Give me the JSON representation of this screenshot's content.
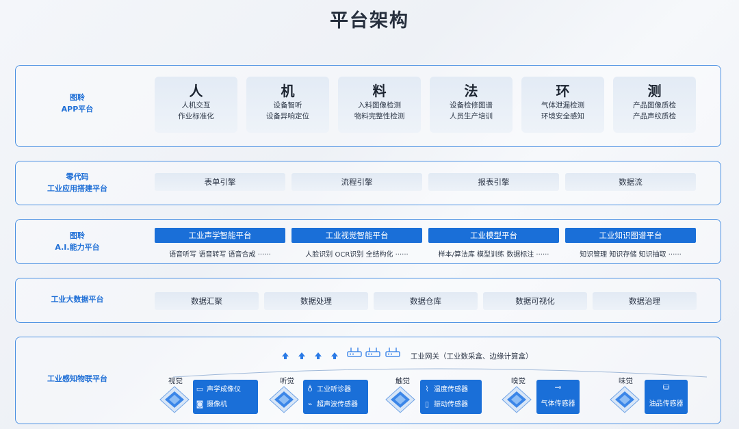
{
  "title": "平台架构",
  "band1": {
    "label_line1": "图聆",
    "label_line2": "APP平台",
    "cards": [
      {
        "big": "人",
        "l1": "人机交互",
        "l2": "作业标准化"
      },
      {
        "big": "机",
        "l1": "设备智听",
        "l2": "设备异响定位"
      },
      {
        "big": "料",
        "l1": "入料图像检测",
        "l2": "物料完整性检测"
      },
      {
        "big": "法",
        "l1": "设备检修图谱",
        "l2": "人员生产培训"
      },
      {
        "big": "环",
        "l1": "气体泄漏检测",
        "l2": "环境安全感知"
      },
      {
        "big": "测",
        "l1": "产品图像质检",
        "l2": "产品声纹质检"
      }
    ]
  },
  "band2": {
    "label_line1": "零代码",
    "label_line2": "工业应用搭建平台",
    "items": [
      "表单引擎",
      "流程引擎",
      "报表引擎",
      "数据流"
    ]
  },
  "band3": {
    "label_line1": "图聆",
    "label_line2": "A.I.能力平台",
    "platforms": [
      {
        "name": "工业声学智能平台",
        "sub": "语音听写  语音转写  语音合成  ······"
      },
      {
        "name": "工业视觉智能平台",
        "sub": "人脸识别  OCR识别  全结构化  ······"
      },
      {
        "name": "工业模型平台",
        "sub": "样本/算法库  模型训练  数据标注  ······"
      },
      {
        "name": "工业知识图谱平台",
        "sub": "知识管理  知识存储  知识抽取  ······"
      }
    ]
  },
  "band4": {
    "label": "工业大数据平台",
    "items": [
      "数据汇聚",
      "数据处理",
      "数据仓库",
      "数据可视化",
      "数据治理"
    ]
  },
  "band5": {
    "label": "工业感知物联平台",
    "gateway": "工业网关（工业数采盒、边缘计算盒）",
    "senses": [
      {
        "label": "视觉",
        "items": [
          "声学成像仪",
          "摄像机"
        ]
      },
      {
        "label": "听觉",
        "items": [
          "工业听诊器",
          "超声波传感器"
        ]
      },
      {
        "label": "触觉",
        "items": [
          "温度传感器",
          "振动传感器"
        ]
      },
      {
        "label": "嗅觉",
        "items": [
          "气体传感器"
        ]
      },
      {
        "label": "味觉",
        "items": [
          "油品传感器"
        ]
      }
    ]
  },
  "colors": {
    "accent": "#1a6fd8",
    "border": "#4a90e2",
    "label": "#1f6fd6"
  }
}
